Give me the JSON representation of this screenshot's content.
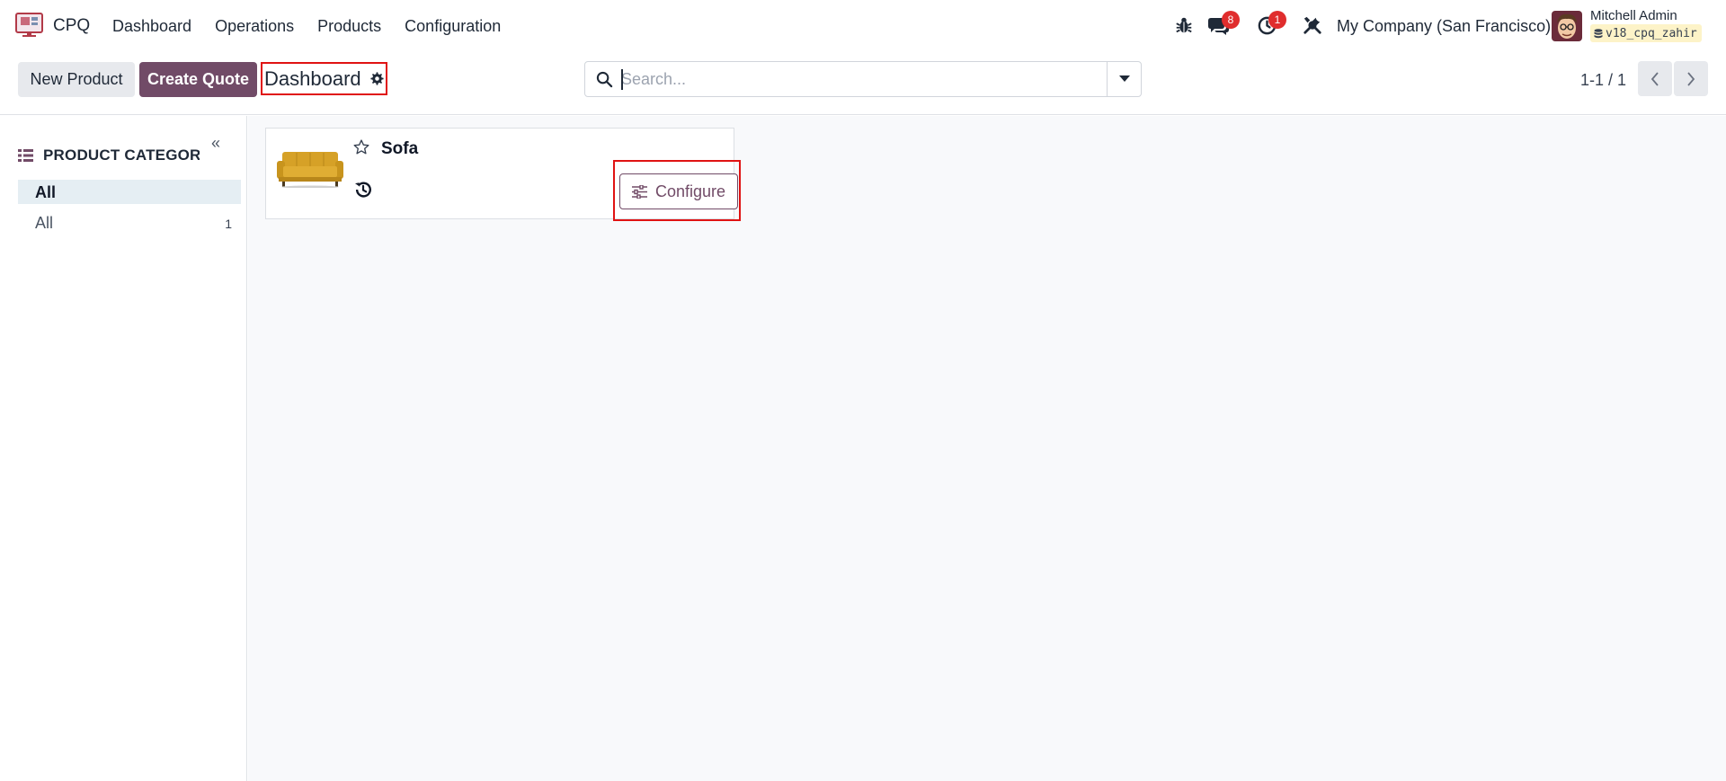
{
  "navbar": {
    "app_name": "CPQ",
    "menu": [
      "Dashboard",
      "Operations",
      "Products",
      "Configuration"
    ],
    "messages_count": "8",
    "activities_count": "1",
    "company": "My Company (San Francisco)",
    "user_name": "Mitchell Admin",
    "database": "v18_cpq_zahir"
  },
  "control": {
    "new_product_label": "New Product",
    "create_quote_label": "Create Quote",
    "breadcrumb": "Dashboard",
    "search_placeholder": "Search...",
    "pager": "1-1 / 1"
  },
  "sidebar": {
    "title": "PRODUCT CATEGORY",
    "items": [
      {
        "label": "All"
      },
      {
        "label": "All",
        "count": "1"
      }
    ]
  },
  "card": {
    "title": "Sofa",
    "configure_label": "Configure"
  },
  "colors": {
    "brand": "#714b67",
    "badge": "#e02d2d",
    "highlight_box": "#e01313"
  }
}
